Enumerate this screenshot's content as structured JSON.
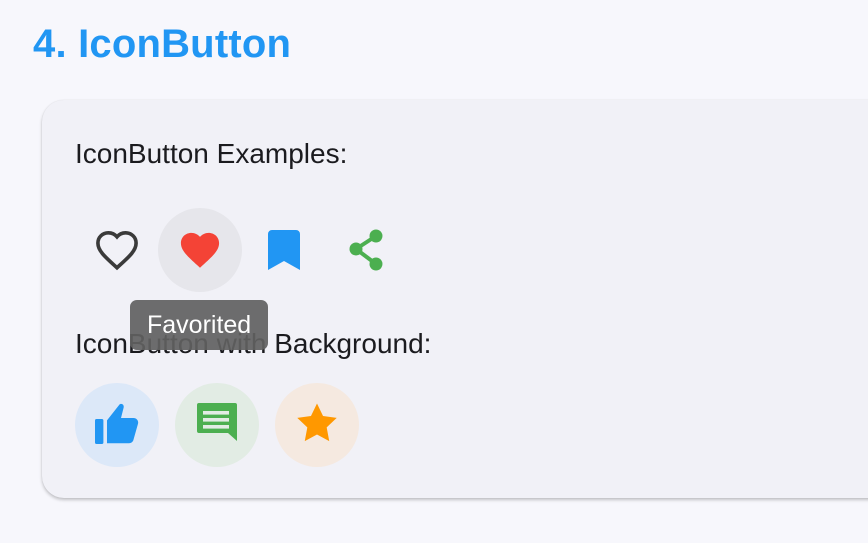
{
  "section": {
    "title": "4. IconButton"
  },
  "card": {
    "heading": "IconButton Examples:",
    "icon_buttons": [
      {
        "icon": "heart-outline-icon",
        "color": "#3a3a3a"
      },
      {
        "icon": "heart-filled-icon",
        "color": "#f44336",
        "hovered": true
      },
      {
        "icon": "bookmark-icon",
        "color": "#2196f3"
      },
      {
        "icon": "share-icon",
        "color": "#4caf50"
      }
    ],
    "tooltip": "Favorited",
    "background_label": "IconButton with Background:",
    "background_buttons": [
      {
        "icon": "thumb-up-icon",
        "color": "#2196f3",
        "background": "#dce8f8"
      },
      {
        "icon": "comment-icon",
        "color": "#4caf50",
        "background": "#e2ece4"
      },
      {
        "icon": "star-icon",
        "color": "#ff9800",
        "background": "#f5e9e0"
      }
    ]
  },
  "colors": {
    "accent": "#2196f3",
    "page_background": "#f7f7fc",
    "card_background": "#f1f1f7"
  }
}
